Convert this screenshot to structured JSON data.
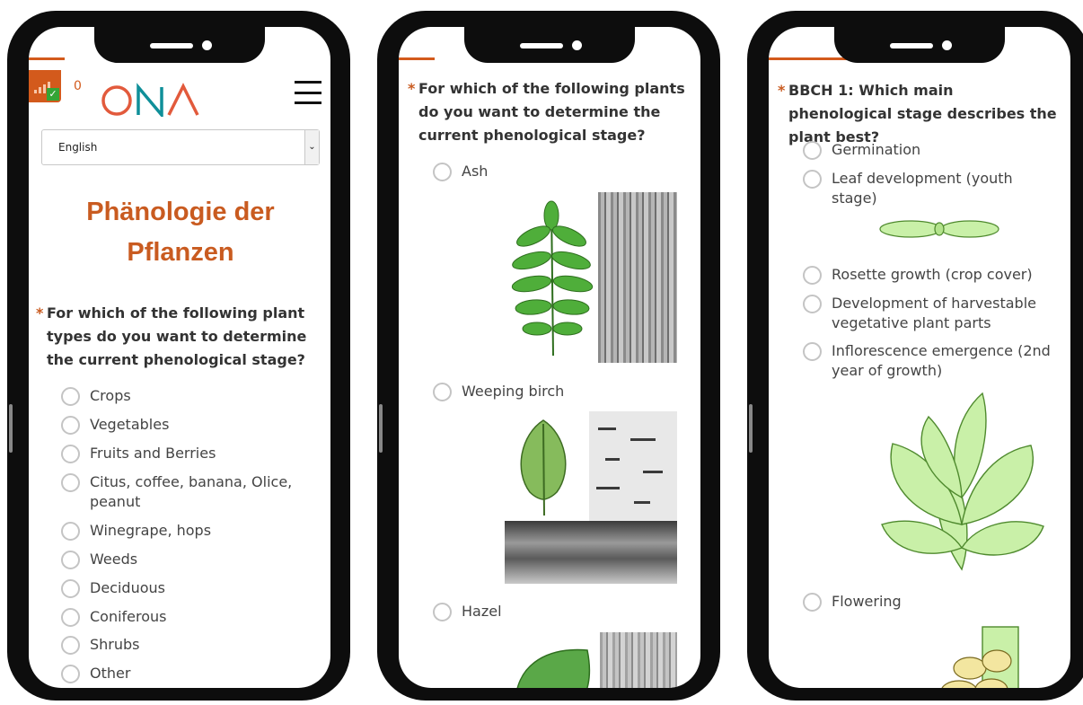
{
  "phone1": {
    "count": "0",
    "language": "English",
    "title": "Phänologie der Pflanzen",
    "question": "For which of the following plant types do you want to determine the current phenological stage?",
    "options": [
      "Crops",
      "Vegetables",
      "Fruits and Berries",
      "Citus, coffee, banana, Olice, peanut",
      "Winegrape, hops",
      "Weeds",
      "Deciduous",
      "Coniferous",
      "Shrubs",
      "Other"
    ]
  },
  "phone2": {
    "question": "For which of the following plants do you want to determine the current phenological stage?",
    "options": [
      "Ash",
      "Weeping birch",
      "Hazel"
    ]
  },
  "phone3": {
    "question": "BBCH 1: Which main phenological stage describes the plant best?",
    "options": [
      "Germination",
      "Leaf development (youth stage)",
      "Rosette growth (crop cover)",
      "Development of harvestable vegetative plant parts",
      "Inflorescence emergence (2nd year of growth)",
      "Flowering"
    ]
  },
  "colors": {
    "accent": "#d35a1c",
    "check": "#35a535",
    "plant_green": "#c9f0a8"
  },
  "logo_text": "ONA"
}
